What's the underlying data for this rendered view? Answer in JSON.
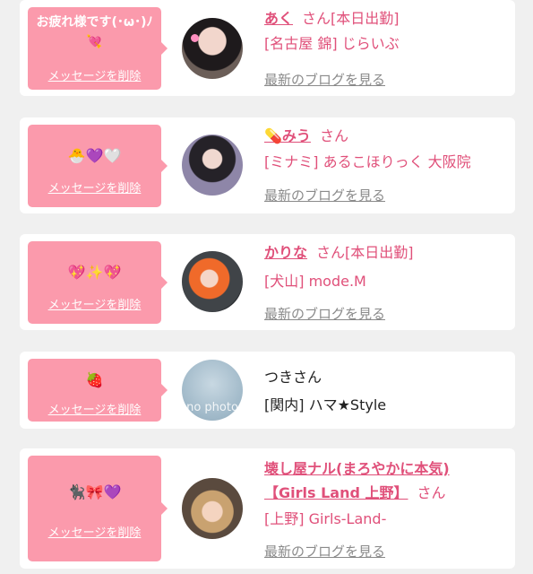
{
  "delete_label": "メッセージを削除",
  "blog_link_label": "最新のブログを見る",
  "items": [
    {
      "message": "お疲れ様です(･ω･)ﾉ💘",
      "name": "あく",
      "suffix": "さん",
      "status": "[本日出勤]",
      "shop": "[名古屋 錦] じらいぶ",
      "has_blog": true
    },
    {
      "message": "🐣💜🤍",
      "name": "💊みう",
      "suffix": "さん",
      "status": "",
      "shop": "[ミナミ] あるこほりっく 大阪院",
      "has_blog": true
    },
    {
      "message": "💖✨💖",
      "name": "かりな",
      "suffix": "さん",
      "status": "[本日出勤]",
      "shop": "[犬山] mode.M",
      "has_blog": true
    },
    {
      "message": "🍓",
      "name": "つきさん",
      "suffix": "",
      "status": "",
      "shop": "[関内] ハマ★Style",
      "avatar_text": "no photo",
      "has_blog": false
    },
    {
      "message": "🐈‍⬛🎀💜",
      "name_line1": "壊し屋ナル(まろやかに本気)",
      "name_line2": "【Girls Land 上野】",
      "suffix": "さん",
      "status": "",
      "shop": "[上野] Girls-Land-",
      "has_blog": true
    }
  ],
  "colors": {
    "bubble": "#fb9aac",
    "accent": "#e0507a",
    "link_gray": "#8a8a8a",
    "background": "#f0f0f0"
  }
}
